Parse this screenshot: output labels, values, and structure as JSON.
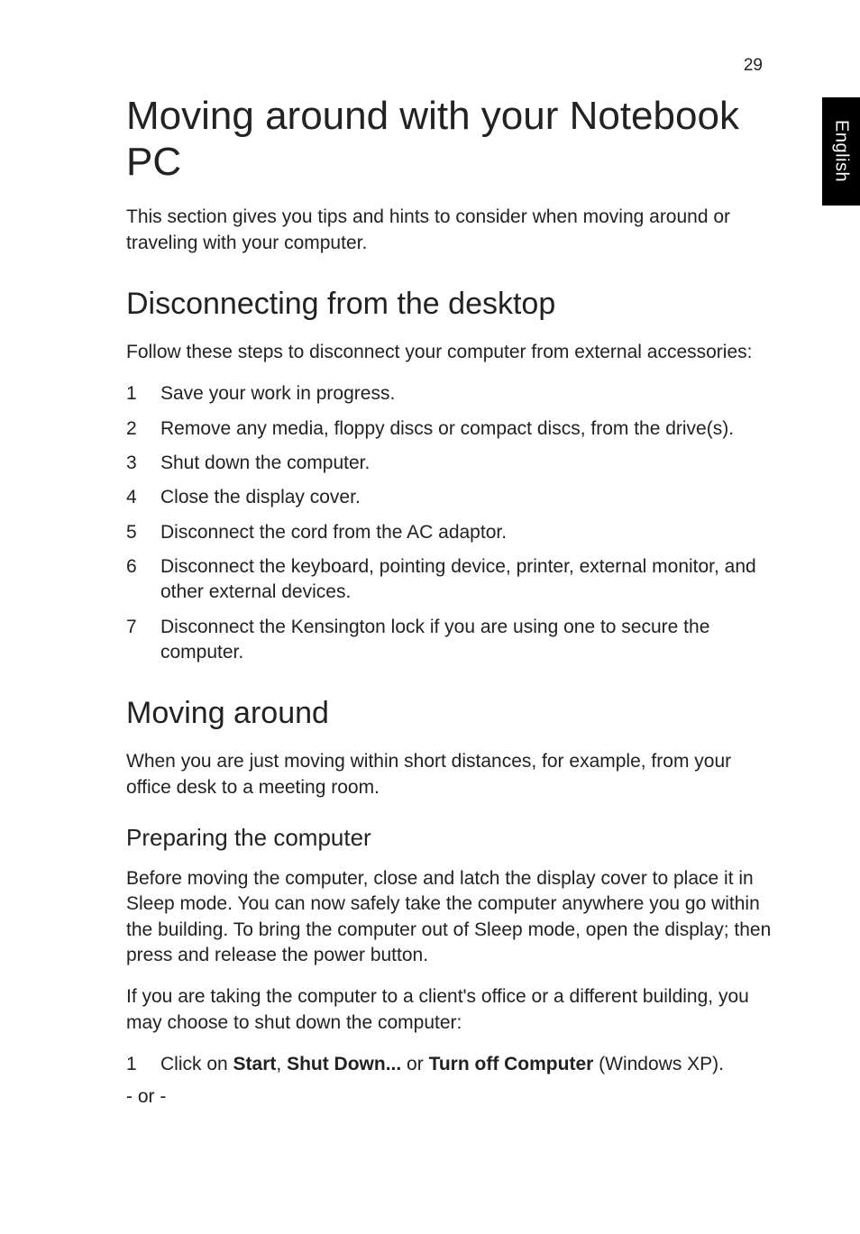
{
  "page_number": "29",
  "language_tab": "English",
  "title": "Moving around with your Notebook PC",
  "intro": "This section gives you tips and hints to consider when moving around or traveling with your computer.",
  "section_disconnect": {
    "heading": "Disconnecting from the desktop",
    "lead": "Follow these steps to disconnect your computer from external accessories:",
    "steps": {
      "n1": "1",
      "t1": "Save your work in progress.",
      "n2": "2",
      "t2": "Remove any media, floppy discs or compact discs, from the drive(s).",
      "n3": "3",
      "t3": "Shut down the computer.",
      "n4": "4",
      "t4": "Close the display cover.",
      "n5": "5",
      "t5": "Disconnect the cord from the AC adaptor.",
      "n6": "6",
      "t6": "Disconnect the keyboard, pointing device, printer, external monitor, and other external devices.",
      "n7": "7",
      "t7": "Disconnect the Kensington lock if you are using one to secure the computer."
    }
  },
  "section_moving": {
    "heading": "Moving around",
    "lead": "When you are just moving within short distances, for example, from your office desk to a meeting room.",
    "sub_heading": "Preparing the computer",
    "p1": "Before moving the computer, close and latch the display cover to place it in Sleep mode. You can now safely take the computer anywhere you go within the building. To bring the computer out of Sleep mode, open the display; then press and release the power button.",
    "p2": "If you are taking the computer to a client's office or a different building, you may choose to shut down the computer:",
    "step1": {
      "num": "1",
      "pre": "Click on ",
      "b1": "Start",
      "sep1": ", ",
      "b2": "Shut Down...",
      "mid": " or ",
      "b3": "Turn off Computer",
      "post": " (Windows XP)."
    },
    "or": "- or -"
  }
}
